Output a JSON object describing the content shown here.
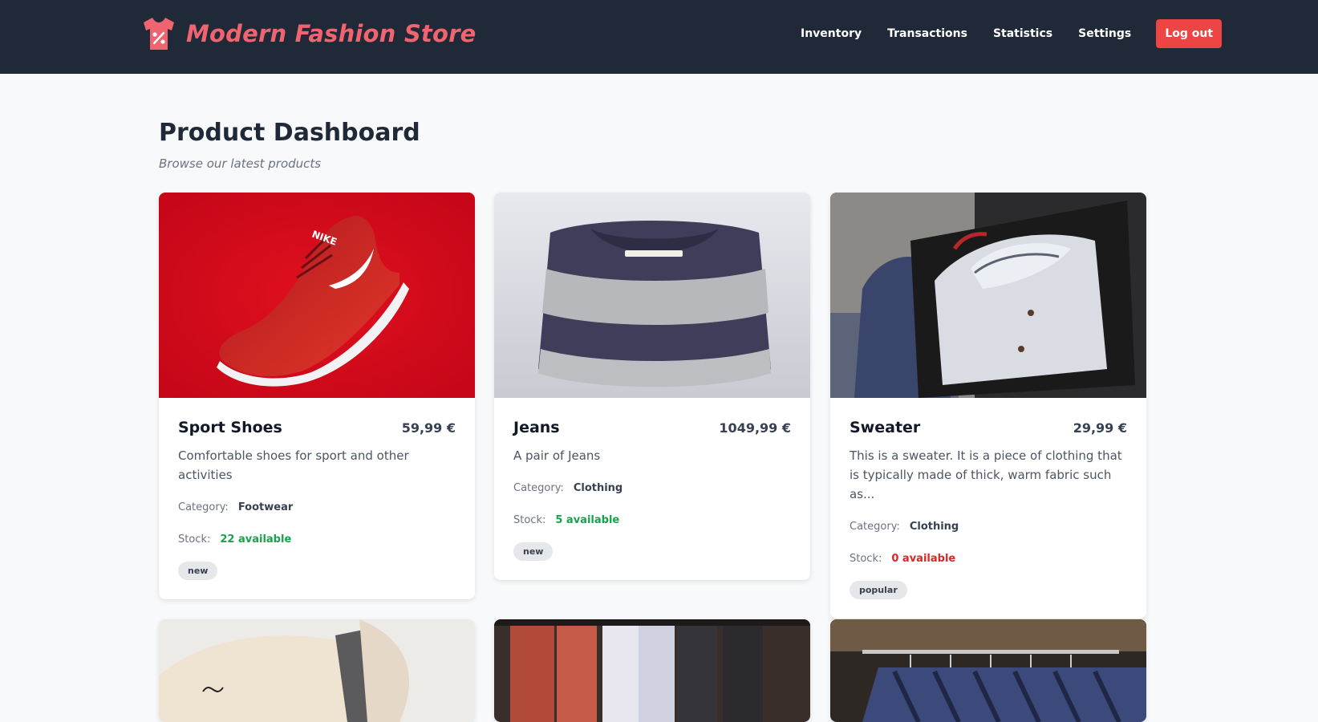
{
  "header": {
    "brand": "Modern Fashion Store",
    "nav": [
      "Inventory",
      "Transactions",
      "Statistics",
      "Settings"
    ],
    "logout_label": "Log out"
  },
  "page": {
    "title": "Product Dashboard",
    "subtitle": "Browse our latest products"
  },
  "labels": {
    "category": "Category:",
    "stock": "Stock:"
  },
  "products": [
    {
      "name": "Sport Shoes",
      "price": "59,99 €",
      "description": "Comfortable shoes for sport and other activities",
      "category": "Footwear",
      "stock": "22 available",
      "tag": "new"
    },
    {
      "name": "Jeans",
      "price": "1049,99 €",
      "description": "A pair of Jeans",
      "category": "Clothing",
      "stock": "5 available",
      "tag": "new"
    },
    {
      "name": "Sweater",
      "price": "29,99 €",
      "description": "This is a sweater. It is a piece of clothing that is typically made of thick, warm fabric such as...",
      "category": "Clothing",
      "stock": "0 available",
      "tag": "popular"
    }
  ],
  "colors": {
    "navbar": "#1f2937",
    "brand": "#f06470",
    "logout": "#ef4444",
    "in_stock": "#16a34a",
    "out_of_stock": "#dc2626"
  },
  "icons": {
    "brand": "tshirt-percent-icon"
  }
}
